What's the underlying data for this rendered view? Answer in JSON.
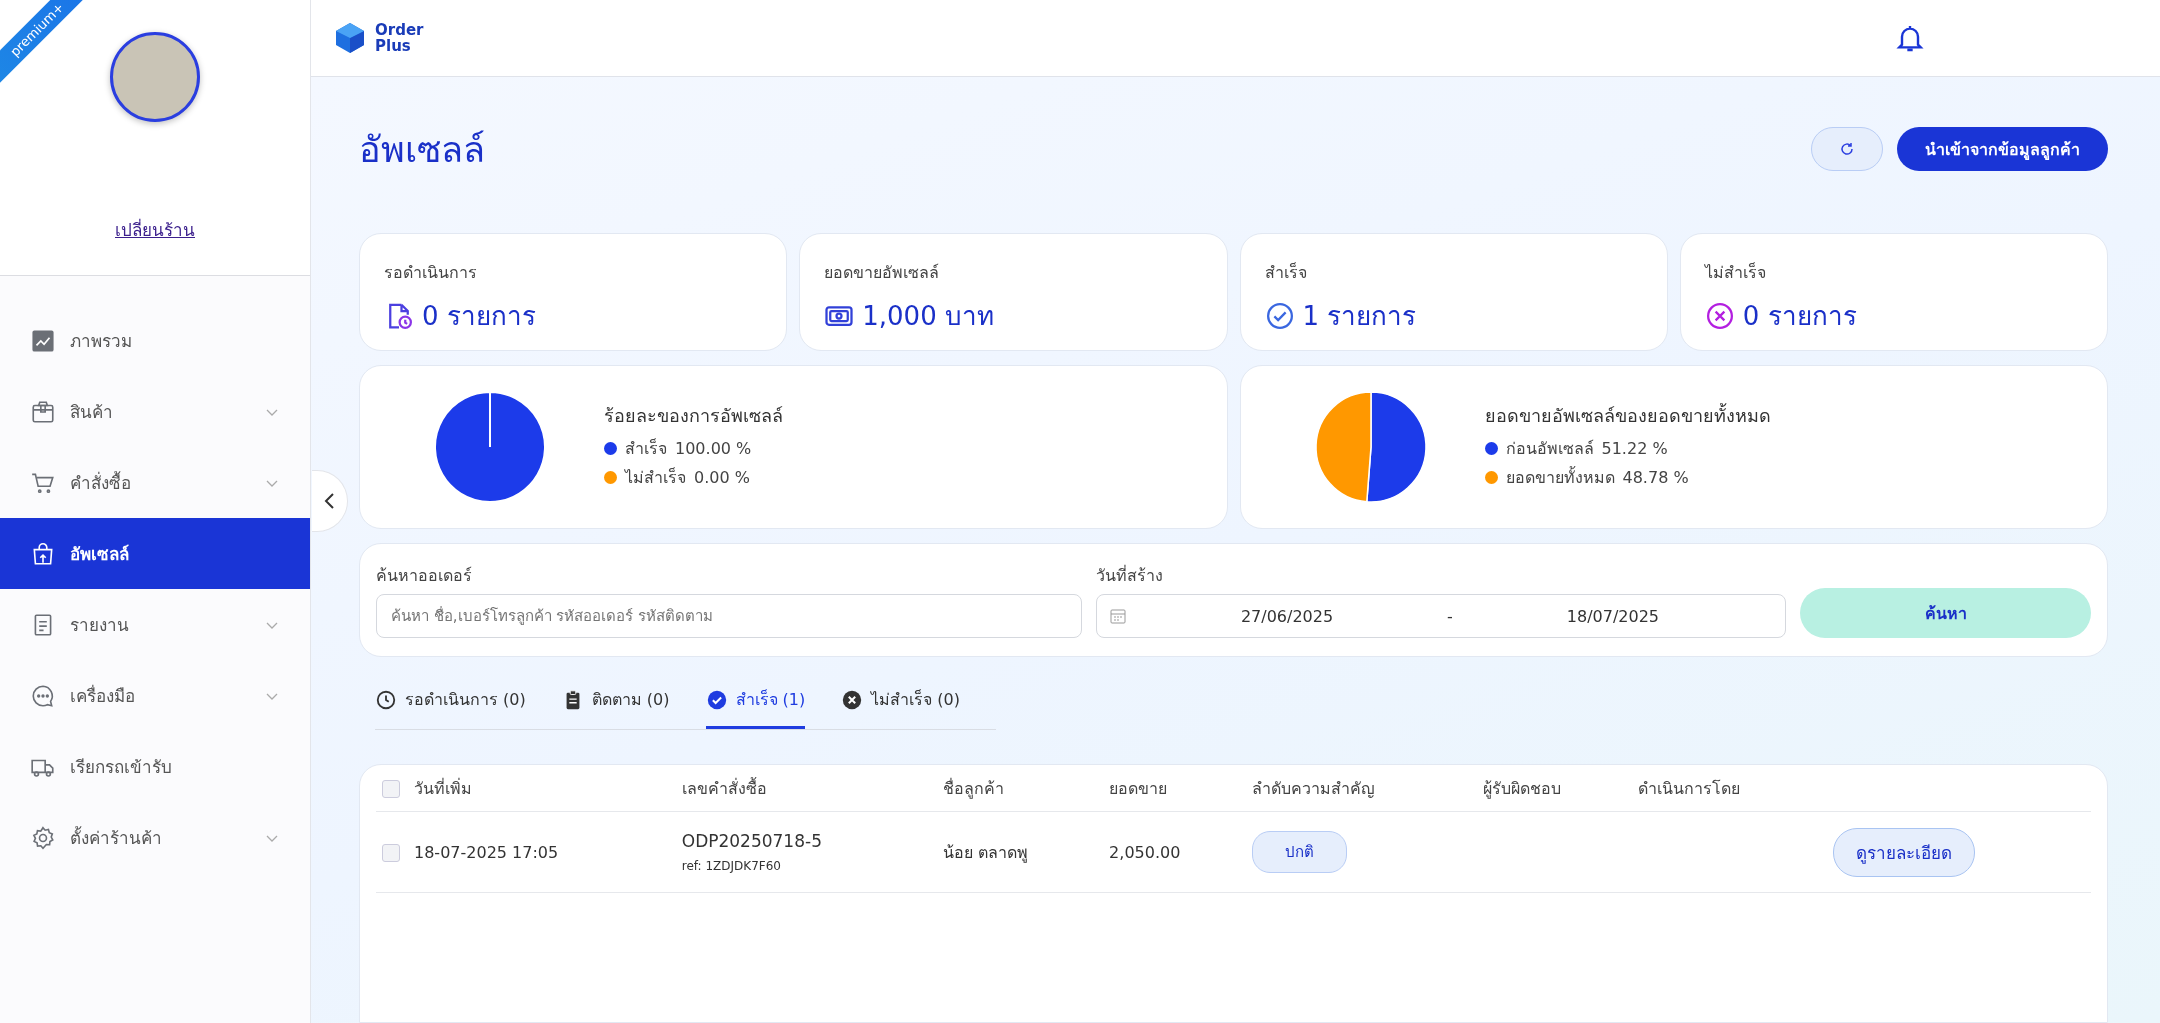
{
  "sidebar": {
    "badge": "premium+",
    "switch_link": "เปลี่ยนร้าน",
    "items": [
      {
        "kind": "chart",
        "label": "ภาพรวม",
        "expandable": false,
        "selected": false
      },
      {
        "kind": "box",
        "label": "สินค้า",
        "expandable": true,
        "selected": false
      },
      {
        "kind": "cart",
        "label": "คำสั่งซื้อ",
        "expandable": true,
        "selected": false
      },
      {
        "kind": "bag",
        "label": "อัพเซลล์",
        "expandable": false,
        "selected": true
      },
      {
        "kind": "doc",
        "label": "รายงาน",
        "expandable": true,
        "selected": false
      },
      {
        "kind": "chat",
        "label": "เครื่องมือ",
        "expandable": true,
        "selected": false
      },
      {
        "kind": "truck",
        "label": "เรียกรถเข้ารับ",
        "expandable": false,
        "selected": false
      },
      {
        "kind": "gear",
        "label": "ตั้งค่าร้านค้า",
        "expandable": true,
        "selected": false
      }
    ]
  },
  "header": {
    "logo_lines": [
      "Order",
      "Plus"
    ]
  },
  "page": {
    "title": "อัพเซลล์",
    "import_button": "นำเข้าจากข้อมูลลูกค้า"
  },
  "stats": [
    {
      "kind": "pending",
      "label": "รอดำเนินการ",
      "value": "0 รายการ"
    },
    {
      "kind": "money",
      "label": "ยอดขายอัพเซลล์",
      "value": "1,000 บาท"
    },
    {
      "kind": "success",
      "label": "สำเร็จ",
      "value": "1 รายการ"
    },
    {
      "kind": "failed",
      "label": "ไม่สำเร็จ",
      "value": "0 รายการ"
    }
  ],
  "charts": [
    {
      "title": "ร้อยละของการอัพเซลล์",
      "legend": [
        {
          "value": "100.00 %",
          "color": "#1c3bea"
        },
        {
          "value": "0.00 %",
          "color": "#ff9800"
        }
      ],
      "chart_data": {
        "type": "pie",
        "categories": [
          "สำเร็จ",
          "ไม่สำเร็จ"
        ],
        "values": [
          100,
          0
        ]
      }
    },
    {
      "title": "ยอดขายอัพเซลล์ของยอดขายทั้งหมด",
      "legend": [
        {
          "value": "51.22 %",
          "color": "#1c3bea"
        },
        {
          "value": "48.78 %",
          "color": "#ff9800"
        }
      ],
      "chart_data": {
        "type": "pie",
        "categories": [
          "ก่อนอัพเซลล์",
          "ยอดขายทั้งหมด"
        ],
        "values": [
          51.22,
          48.78
        ]
      }
    }
  ],
  "search": {
    "order_label": "ค้นหาออเดอร์",
    "placeholder": "ค้นหา ชื่อ,เบอร์โทรลูกค้า รหัสออเดอร์ รหัสติดตาม",
    "date_label": "วันที่สร้าง",
    "date_from": "27/06/2025",
    "date_separator": "-",
    "date_to": "18/07/2025",
    "button": "ค้นหา"
  },
  "tabs": [
    {
      "kind": "clock",
      "label": "รอดำเนินการ (0)",
      "selected": false
    },
    {
      "kind": "clipboard",
      "label": "ติดตาม (0)",
      "selected": false
    },
    {
      "kind": "check",
      "label": "สำเร็จ (1)",
      "selected": true
    },
    {
      "kind": "cross",
      "label": "ไม่สำเร็จ (0)",
      "selected": false
    }
  ],
  "table": {
    "header_checked": false,
    "columns": [
      "วันที่เพิ่ม",
      "เลขคำสั่งซื้อ",
      "ชื่อลูกค้า",
      "ยอดขาย",
      "ลำดับความสำคัญ",
      "ผู้รับผิดชอบ",
      "ดำเนินการโดย"
    ],
    "rows": [
      {
        "checked": false,
        "date": "18-07-2025 17:05",
        "order_no": "ODP20250718-5",
        "ref": "ref: 1ZDJDK7F60",
        "customer": "น้อย ตลาดพู",
        "amount": "2,050.00",
        "priority": "ปกติ",
        "action": "ดูรายละเอียด"
      }
    ]
  }
}
